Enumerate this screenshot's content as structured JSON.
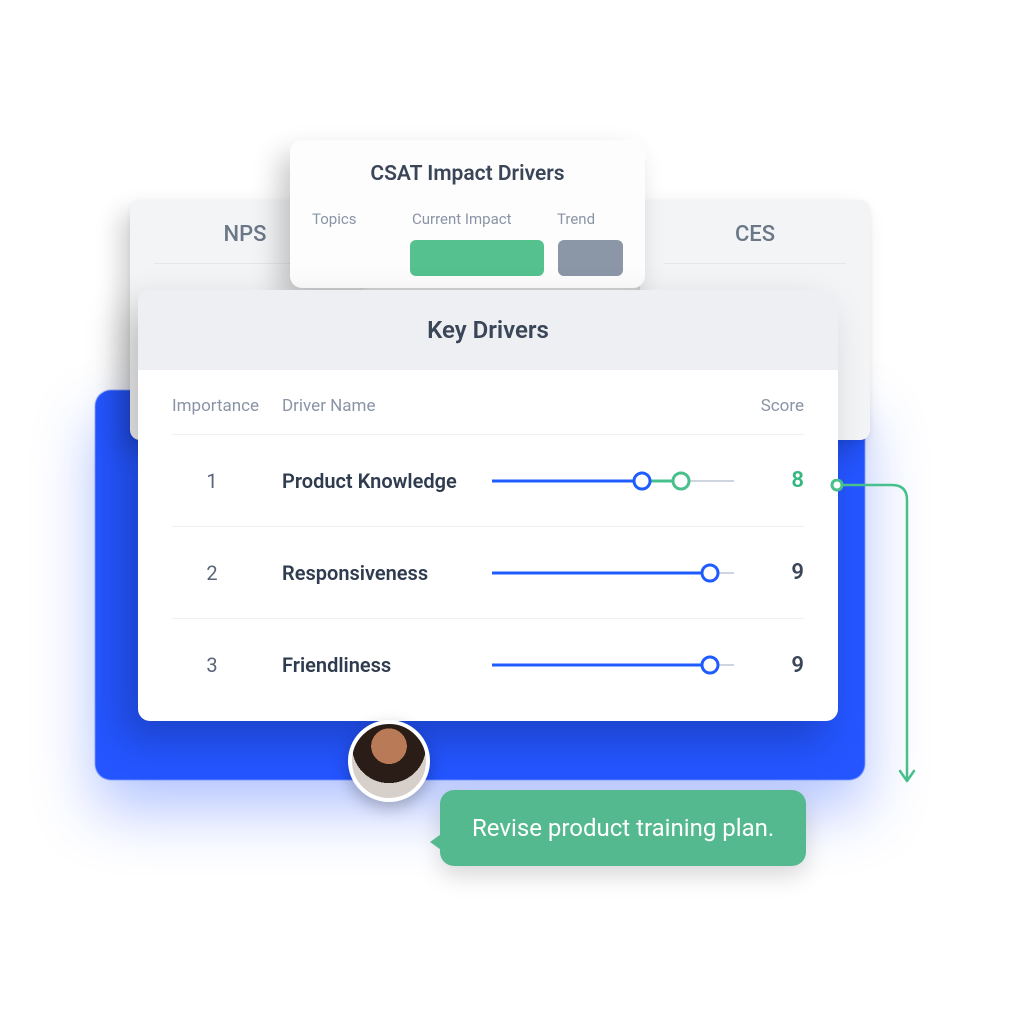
{
  "mini_nps": {
    "title": "NPS"
  },
  "mini_ces": {
    "title": "CES"
  },
  "csat": {
    "title": "CSAT Impact Drivers",
    "cols": {
      "topics": "Topics",
      "impact": "Current Impact",
      "trend": "Trend"
    }
  },
  "key_drivers": {
    "title": "Key Drivers",
    "cols": {
      "importance": "Importance",
      "name": "Driver Name",
      "score": "Score"
    },
    "rows": [
      {
        "rank": "1",
        "name": "Product Knowledge",
        "score": "8",
        "blue_pct": 62,
        "green_start": 62,
        "green_end": 78,
        "score_color": "green"
      },
      {
        "rank": "2",
        "name": "Responsiveness",
        "score": "9",
        "blue_pct": 90,
        "score_color": "default"
      },
      {
        "rank": "3",
        "name": "Friendliness",
        "score": "9",
        "blue_pct": 90,
        "score_color": "default"
      }
    ]
  },
  "bubble": {
    "text": "Revise product training plan."
  },
  "colors": {
    "green": "#48c08b",
    "blue": "#1f5cff"
  }
}
